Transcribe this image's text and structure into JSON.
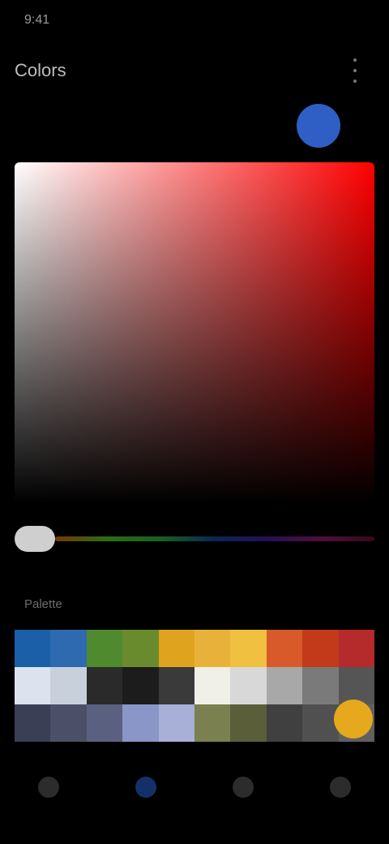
{
  "status": {
    "time": "9:41"
  },
  "header": {
    "title": "Colors"
  },
  "preview": {
    "color": "#2f5fc4"
  },
  "picker": {
    "hue_color": "#ff0000",
    "saturation": 0.0,
    "value": 0.0
  },
  "hue_slider": {
    "hue": 0
  },
  "palette": {
    "label": "Palette",
    "rows": [
      [
        "#1a5fa8",
        "#2d6ab0",
        "#4f8a2e",
        "#6a8a2e",
        "#e0a31e",
        "#e8b23a",
        "#f0c040",
        "#d85a2a",
        "#c23a1a",
        "#b52a2a"
      ],
      [
        "#dde3ee",
        "#c8d0dc",
        "#2a2a2a",
        "#1c1c1c",
        "#3a3a3a",
        "#f0efe8",
        "#d8d8d8",
        "#a8a8a8",
        "#7a7a7a",
        "#555555"
      ],
      [
        "#3a3f55",
        "#4b5068",
        "#5a6080",
        "#8a95c8",
        "#a8b0d8",
        "#7a8050",
        "#5a5f3a",
        "#404040",
        "#505050",
        "#606060"
      ]
    ]
  },
  "favorite": {
    "color": "#e6a81c"
  },
  "nav": {
    "items": [
      {
        "name": "nav-item-1",
        "active": false
      },
      {
        "name": "nav-item-2",
        "active": true
      },
      {
        "name": "nav-item-3",
        "active": false
      },
      {
        "name": "nav-item-4",
        "active": false
      }
    ]
  }
}
